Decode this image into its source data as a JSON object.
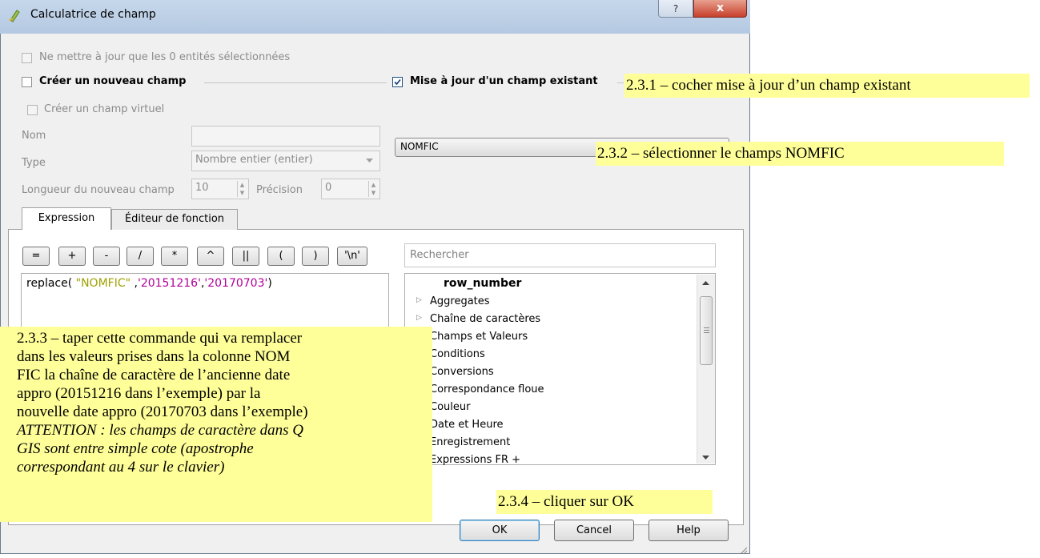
{
  "window": {
    "title": "Calculatrice de champ",
    "help_glyph": "?",
    "close_glyph": "x"
  },
  "options": {
    "only_selected_label": "Ne mettre à jour que les 0 entités sélectionnées",
    "create_new_field_label": "Créer un nouveau champ",
    "update_existing_label": "Mise à jour d'un champ existant",
    "create_virtual_label": "Créer un champ virtuel",
    "update_existing_checked": true
  },
  "new_field": {
    "name_label": "Nom",
    "name_value": "",
    "type_label": "Type",
    "type_value": "Nombre entier (entier)",
    "length_label": "Longueur du nouveau champ",
    "length_value": "10",
    "precision_label": "Précision",
    "precision_value": "0"
  },
  "existing_field": {
    "selected": "NOMFIC"
  },
  "tabs": [
    {
      "label": "Expression",
      "active": true
    },
    {
      "label": "Éditeur de fonction",
      "active": false
    }
  ],
  "operators": [
    "=",
    "+",
    "-",
    "/",
    "*",
    "^",
    "||",
    "(",
    ")",
    "'\\n'"
  ],
  "search": {
    "placeholder": "Rechercher"
  },
  "expression": {
    "prefix": "replace( ",
    "field": "\"NOMFIC\"",
    "sep1": " ,",
    "str1": "'20151216'",
    "sep2": ",",
    "str2": "'20170703'",
    "suffix": ")"
  },
  "function_list": [
    {
      "label": "row_number",
      "bold": true,
      "expandable": false
    },
    {
      "label": "Aggregates",
      "expandable": true
    },
    {
      "label": "Chaîne de caractères",
      "expandable": true
    },
    {
      "label": "Champs et Valeurs",
      "expandable": false
    },
    {
      "label": "Conditions",
      "expandable": false
    },
    {
      "label": "Conversions",
      "expandable": false
    },
    {
      "label": "Correspondance floue",
      "expandable": false
    },
    {
      "label": "Couleur",
      "expandable": false
    },
    {
      "label": "Date et Heure",
      "expandable": false
    },
    {
      "label": "Enregistrement",
      "expandable": false
    },
    {
      "label": "Expressions FR +",
      "expandable": false
    }
  ],
  "buttons": {
    "ok": "OK",
    "cancel": "Cancel",
    "help": "Help"
  },
  "annotations": {
    "step_231": "2.3.1 – cocher mise à jour d’un champ existant",
    "step_232": "2.3.2 – sélectionner le champs NOMFIC",
    "step_233_lines": [
      "2.3.3 – taper cette commande qui va remplacer",
      "dans les valeurs prises dans la colonne NOM",
      "FIC la chaîne de caractère de l’ancienne date",
      "appro (20151216 dans l’exemple) par la",
      "nouvelle date appro (20170703 dans l’exemple)"
    ],
    "step_233_warning_lines": [
      "ATTENTION : les champs de caractère dans Q",
      "GIS sont entre simple cote (apostrophe",
      "correspondant au 4 sur le clavier)"
    ],
    "step_234": "2.3.4 – cliquer sur OK"
  },
  "colors": {
    "highlight": "#ffff99",
    "field_token": "#a0a000",
    "string_token": "#b1009a",
    "close_button": "#c7402b"
  }
}
